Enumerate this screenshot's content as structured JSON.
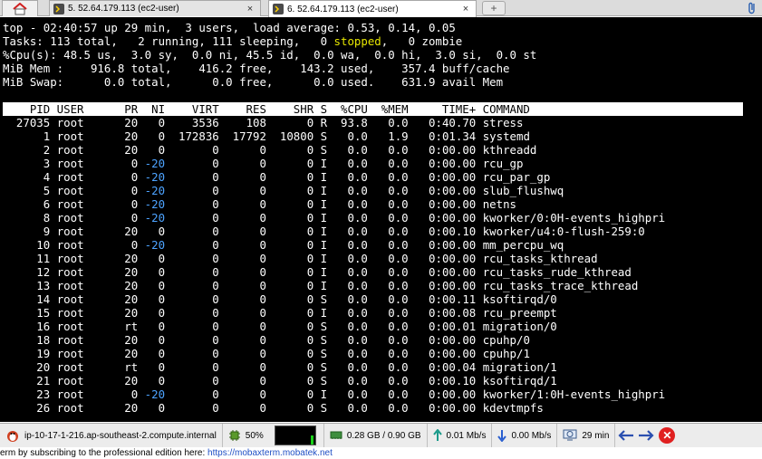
{
  "tabs": [
    {
      "label": "5. 52.64.179.113 (ec2-user)",
      "active": false
    },
    {
      "label": "6. 52.64.179.113 (ec2-user)",
      "active": true
    }
  ],
  "tab_close_glyph": "×",
  "newtab_glyph": "+",
  "terminal": {
    "summary": {
      "line1": "top - 02:40:57 up 29 min,  3 users,  load average: 0.53, 0.14, 0.05",
      "line2_pre": "Tasks: 113 total,   2 running, 111 sleeping,   0 ",
      "line2_stopped": "stopped",
      "line2_post": ",   0 zombie",
      "line3": "%Cpu(s): 48.5 us,  3.0 sy,  0.0 ni, 45.5 id,  0.0 wa,  0.0 hi,  3.0 si,  0.0 st",
      "line4": "MiB Mem :    916.8 total,    416.2 free,    143.2 used,    357.4 buff/cache",
      "line5": "MiB Swap:      0.0 total,      0.0 free,      0.0 used.    631.9 avail Mem"
    },
    "header": "    PID USER      PR  NI    VIRT    RES    SHR S  %CPU  %MEM     TIME+ COMMAND",
    "processes": [
      {
        "pid": "27035",
        "user": "root",
        "pr": "20",
        "ni": "0",
        "virt": "3536",
        "res": "108",
        "shr": "0",
        "s": "R",
        "cpu": "93.8",
        "mem": "0.0",
        "time": "0:40.70",
        "cmd": "stress"
      },
      {
        "pid": "1",
        "user": "root",
        "pr": "20",
        "ni": "0",
        "virt": "172836",
        "res": "17792",
        "shr": "10800",
        "s": "S",
        "cpu": "0.0",
        "mem": "1.9",
        "time": "0:01.34",
        "cmd": "systemd"
      },
      {
        "pid": "2",
        "user": "root",
        "pr": "20",
        "ni": "0",
        "virt": "0",
        "res": "0",
        "shr": "0",
        "s": "S",
        "cpu": "0.0",
        "mem": "0.0",
        "time": "0:00.00",
        "cmd": "kthreadd"
      },
      {
        "pid": "3",
        "user": "root",
        "pr": "0",
        "ni": "-20",
        "virt": "0",
        "res": "0",
        "shr": "0",
        "s": "I",
        "cpu": "0.0",
        "mem": "0.0",
        "time": "0:00.00",
        "cmd": "rcu_gp"
      },
      {
        "pid": "4",
        "user": "root",
        "pr": "0",
        "ni": "-20",
        "virt": "0",
        "res": "0",
        "shr": "0",
        "s": "I",
        "cpu": "0.0",
        "mem": "0.0",
        "time": "0:00.00",
        "cmd": "rcu_par_gp"
      },
      {
        "pid": "5",
        "user": "root",
        "pr": "0",
        "ni": "-20",
        "virt": "0",
        "res": "0",
        "shr": "0",
        "s": "I",
        "cpu": "0.0",
        "mem": "0.0",
        "time": "0:00.00",
        "cmd": "slub_flushwq"
      },
      {
        "pid": "6",
        "user": "root",
        "pr": "0",
        "ni": "-20",
        "virt": "0",
        "res": "0",
        "shr": "0",
        "s": "I",
        "cpu": "0.0",
        "mem": "0.0",
        "time": "0:00.00",
        "cmd": "netns"
      },
      {
        "pid": "8",
        "user": "root",
        "pr": "0",
        "ni": "-20",
        "virt": "0",
        "res": "0",
        "shr": "0",
        "s": "I",
        "cpu": "0.0",
        "mem": "0.0",
        "time": "0:00.00",
        "cmd": "kworker/0:0H-events_highpri"
      },
      {
        "pid": "9",
        "user": "root",
        "pr": "20",
        "ni": "0",
        "virt": "0",
        "res": "0",
        "shr": "0",
        "s": "I",
        "cpu": "0.0",
        "mem": "0.0",
        "time": "0:00.10",
        "cmd": "kworker/u4:0-flush-259:0"
      },
      {
        "pid": "10",
        "user": "root",
        "pr": "0",
        "ni": "-20",
        "virt": "0",
        "res": "0",
        "shr": "0",
        "s": "I",
        "cpu": "0.0",
        "mem": "0.0",
        "time": "0:00.00",
        "cmd": "mm_percpu_wq"
      },
      {
        "pid": "11",
        "user": "root",
        "pr": "20",
        "ni": "0",
        "virt": "0",
        "res": "0",
        "shr": "0",
        "s": "I",
        "cpu": "0.0",
        "mem": "0.0",
        "time": "0:00.00",
        "cmd": "rcu_tasks_kthread"
      },
      {
        "pid": "12",
        "user": "root",
        "pr": "20",
        "ni": "0",
        "virt": "0",
        "res": "0",
        "shr": "0",
        "s": "I",
        "cpu": "0.0",
        "mem": "0.0",
        "time": "0:00.00",
        "cmd": "rcu_tasks_rude_kthread"
      },
      {
        "pid": "13",
        "user": "root",
        "pr": "20",
        "ni": "0",
        "virt": "0",
        "res": "0",
        "shr": "0",
        "s": "I",
        "cpu": "0.0",
        "mem": "0.0",
        "time": "0:00.00",
        "cmd": "rcu_tasks_trace_kthread"
      },
      {
        "pid": "14",
        "user": "root",
        "pr": "20",
        "ni": "0",
        "virt": "0",
        "res": "0",
        "shr": "0",
        "s": "S",
        "cpu": "0.0",
        "mem": "0.0",
        "time": "0:00.11",
        "cmd": "ksoftirqd/0"
      },
      {
        "pid": "15",
        "user": "root",
        "pr": "20",
        "ni": "0",
        "virt": "0",
        "res": "0",
        "shr": "0",
        "s": "I",
        "cpu": "0.0",
        "mem": "0.0",
        "time": "0:00.08",
        "cmd": "rcu_preempt"
      },
      {
        "pid": "16",
        "user": "root",
        "pr": "rt",
        "ni": "0",
        "virt": "0",
        "res": "0",
        "shr": "0",
        "s": "S",
        "cpu": "0.0",
        "mem": "0.0",
        "time": "0:00.01",
        "cmd": "migration/0"
      },
      {
        "pid": "18",
        "user": "root",
        "pr": "20",
        "ni": "0",
        "virt": "0",
        "res": "0",
        "shr": "0",
        "s": "S",
        "cpu": "0.0",
        "mem": "0.0",
        "time": "0:00.00",
        "cmd": "cpuhp/0"
      },
      {
        "pid": "19",
        "user": "root",
        "pr": "20",
        "ni": "0",
        "virt": "0",
        "res": "0",
        "shr": "0",
        "s": "S",
        "cpu": "0.0",
        "mem": "0.0",
        "time": "0:00.00",
        "cmd": "cpuhp/1"
      },
      {
        "pid": "20",
        "user": "root",
        "pr": "rt",
        "ni": "0",
        "virt": "0",
        "res": "0",
        "shr": "0",
        "s": "S",
        "cpu": "0.0",
        "mem": "0.0",
        "time": "0:00.04",
        "cmd": "migration/1"
      },
      {
        "pid": "21",
        "user": "root",
        "pr": "20",
        "ni": "0",
        "virt": "0",
        "res": "0",
        "shr": "0",
        "s": "S",
        "cpu": "0.0",
        "mem": "0.0",
        "time": "0:00.10",
        "cmd": "ksoftirqd/1"
      },
      {
        "pid": "23",
        "user": "root",
        "pr": "0",
        "ni": "-20",
        "virt": "0",
        "res": "0",
        "shr": "0",
        "s": "I",
        "cpu": "0.0",
        "mem": "0.0",
        "time": "0:00.00",
        "cmd": "kworker/1:0H-events_highpri"
      },
      {
        "pid": "26",
        "user": "root",
        "pr": "20",
        "ni": "0",
        "virt": "0",
        "res": "0",
        "shr": "0",
        "s": "S",
        "cpu": "0.0",
        "mem": "0.0",
        "time": "0:00.00",
        "cmd": "kdevtmpfs"
      }
    ]
  },
  "statusbar": {
    "host": "ip-10-17-1-216.ap-southeast-2.compute.internal",
    "cpu_percent": "50%",
    "cpu_level": 0.5,
    "memory": "0.28 GB / 0.90 GB",
    "upload": "0.01 Mb/s",
    "download": "0.00 Mb/s",
    "uptime": "29 min"
  },
  "footer": {
    "text": "erm by subscribing to the professional edition here: ",
    "link": "https://mobaxterm.mobatek.net"
  },
  "colors": {
    "terminal_bg": "#000000",
    "terminal_fg": "#ffffff",
    "stopped_highlight": "#e6e600",
    "negative_nice": "#4da3ff",
    "cpu_graph_bar": "#19d119",
    "close_button": "#e02020"
  }
}
